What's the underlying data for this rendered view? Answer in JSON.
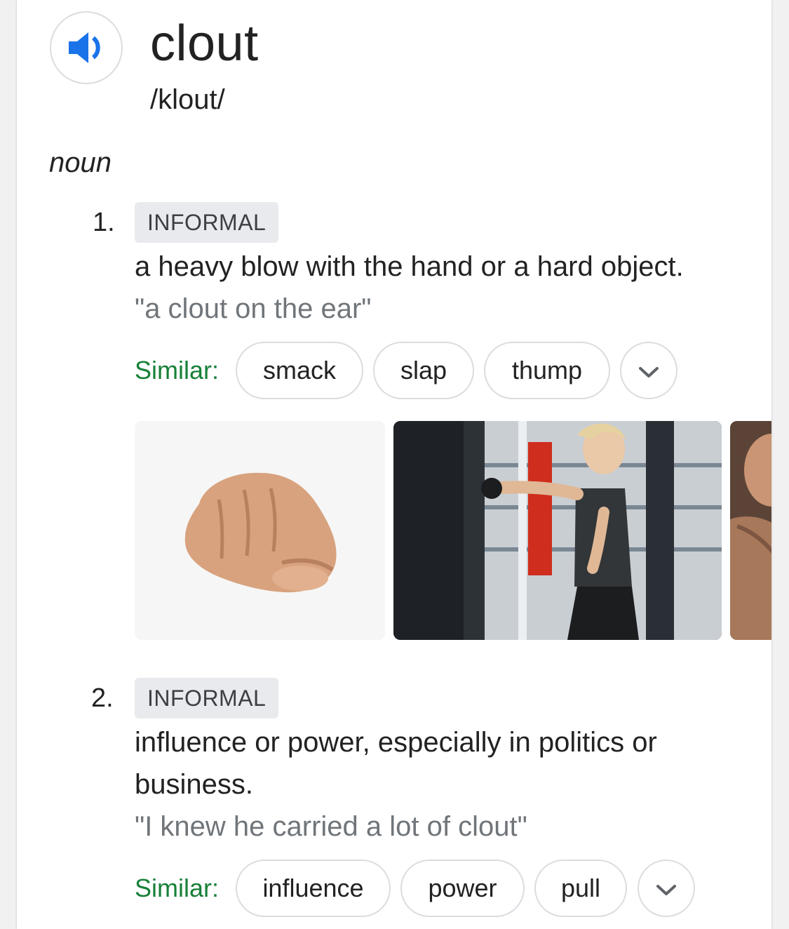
{
  "entry": {
    "word": "clout",
    "phonetic": "/klout/",
    "part_of_speech": "noun",
    "audio_icon": "speaker-volume-icon"
  },
  "senses": [
    {
      "number": "1.",
      "label": "INFORMAL",
      "definition": "a heavy blow with the hand or a hard object.",
      "example": "\"a clout on the ear\"",
      "similar_label": "Similar:",
      "similar": [
        "smack",
        "slap",
        "thump"
      ],
      "more_icon": "chevron-down-icon"
    },
    {
      "number": "2.",
      "label": "INFORMAL",
      "definition": "influence or power, especially in politics or business.",
      "example": "\"I knew he carried a lot of clout\"",
      "similar_label": "Similar:",
      "similar": [
        "influence",
        "power",
        "pull"
      ],
      "more_icon": "chevron-down-icon"
    }
  ],
  "images": [
    {
      "subject": "clenched fist"
    },
    {
      "subject": "woman punching a heavy bag in a boxing gym"
    },
    {
      "subject": "boxer (partially visible)"
    }
  ],
  "colors": {
    "accent_blue": "#1a73e8",
    "similar_green": "#188038",
    "example_gray": "#70757a",
    "chip_border": "#dadce0",
    "label_bg": "#e8eaed"
  }
}
